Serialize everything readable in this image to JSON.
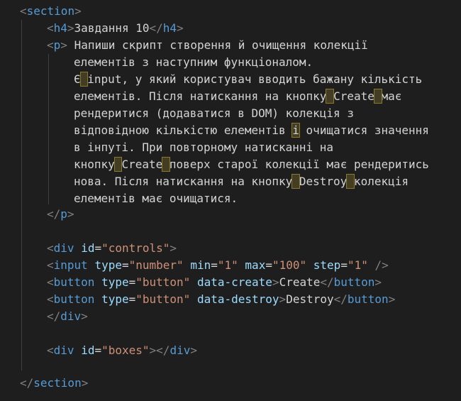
{
  "code": {
    "section_open": "section",
    "section_close": "section",
    "h4_tag": "h4",
    "h4_text": "Завдання 10",
    "p_tag": "p",
    "p_lines": [
      "Напиши скрипт створення й очищення колекції",
      "елементів з наступним функціоналом.",
      "input, у який користувач вводить бажану кількість",
      "елементів. Після натискання на кнопку",
      "Create",
      "має",
      "рендеритися (додаватися в DOM) колекція з",
      "відповідною кількістю елементів",
      "очищатися значення",
      "в інпуті. При повторному натисканні на",
      "кнопку",
      "поверх старої колекції має рендеритись",
      "нова. Після натискання на кнопку",
      "Destroy",
      "колекція",
      "елементів має очищатися."
    ],
    "p_char_e": "Є",
    "p_char_i": "і",
    "div_tag": "div",
    "attr_id": "id",
    "controls_value": "\"controls\"",
    "input_tag": "input",
    "attr_type": "type",
    "type_number": "\"number\"",
    "attr_min": "min",
    "min_value": "\"1\"",
    "attr_max": "max",
    "max_value": "\"100\"",
    "attr_step": "step",
    "step_value": "\"1\"",
    "button_tag": "button",
    "type_button": "\"button\"",
    "attr_data_create": "data-create",
    "create_text": "Create",
    "attr_data_destroy": "data-destroy",
    "destroy_text": "Destroy",
    "boxes_value": "\"boxes\""
  }
}
